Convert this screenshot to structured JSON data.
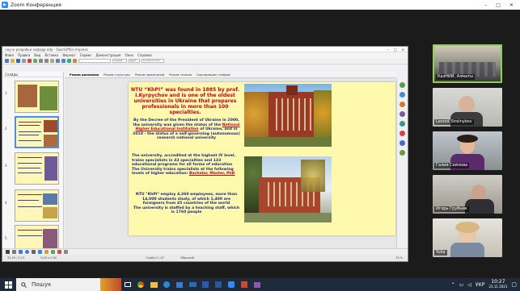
{
  "window": {
    "title": "Zoom Конференция",
    "controls": [
      "–",
      "□",
      "✕"
    ]
  },
  "oo": {
    "title": "научн розробки кафедр.odp - OpenOffice Impress",
    "menu": [
      "Файл",
      "Правка",
      "Вид",
      "Вставка",
      "Формат",
      "Сервис",
      "Демонстрация",
      "Окно",
      "Справка"
    ],
    "toolbar": {
      "box1": "",
      "color": "Серый",
      "box2": "Цвет",
      "box3": "Comfort Color"
    },
    "slides_pane_header": "Слайды",
    "slide_numbers": [
      "1",
      "2",
      "3",
      "4",
      "5"
    ],
    "tabs": [
      "Режим рисования",
      "Режим структуры",
      "Режим примечаний",
      "Режим тезисов",
      "Сортировщик слайдов"
    ],
    "status": {
      "pos": "32,29 / 3,13",
      "size": "0,00 x 0,00",
      "slide": "Слайд 2 / 47",
      "layout": "Обычный",
      "zoom": "76 %"
    }
  },
  "slide": {
    "title": "NTU “KhPI” was found in 1885 by prof. I.Kyrpychov and is one of the oldest universities in Ukraine that prepares professionals in more than 100 specialties.",
    "p1_a": "By the Decree of the President of Ukraine in 2000, the university was given the status of the ",
    "p1_b": "National Higher Educational Institution",
    "p1_c": " of Ukraine, and in 2010 - the status of a self-governing (autonomous) research national university",
    "p2_a": "The university, accredited at the highest IV level, trains specialists in 43 specialties and 133 educational programs for all forms of education",
    "p2_b": "The University trains specialists at the following levels of higher education: ",
    "p2_c": "Bachelor, Master, PhD",
    "p3_a": "NTU \"KhPI\" employ 4,360 employees, more than 14,000 students study, of which 1,400 are foreigners from 45 countries of the world",
    "p3_b": "The university is staffed by a teaching staff, which is 1760 people"
  },
  "participants": [
    {
      "name": "КазНИИ, Алматы",
      "active": true
    },
    {
      "name": "Leonid Strelnykov",
      "active": false
    },
    {
      "name": "Галия Сейлова",
      "active": false
    },
    {
      "name": "Игорь Грубник",
      "active": false
    },
    {
      "name": "Yulia",
      "active": false
    }
  ],
  "taskbar": {
    "search_label": "Пошук",
    "lang": "УКР",
    "time": "10:27",
    "date": "23.11.2021"
  }
}
